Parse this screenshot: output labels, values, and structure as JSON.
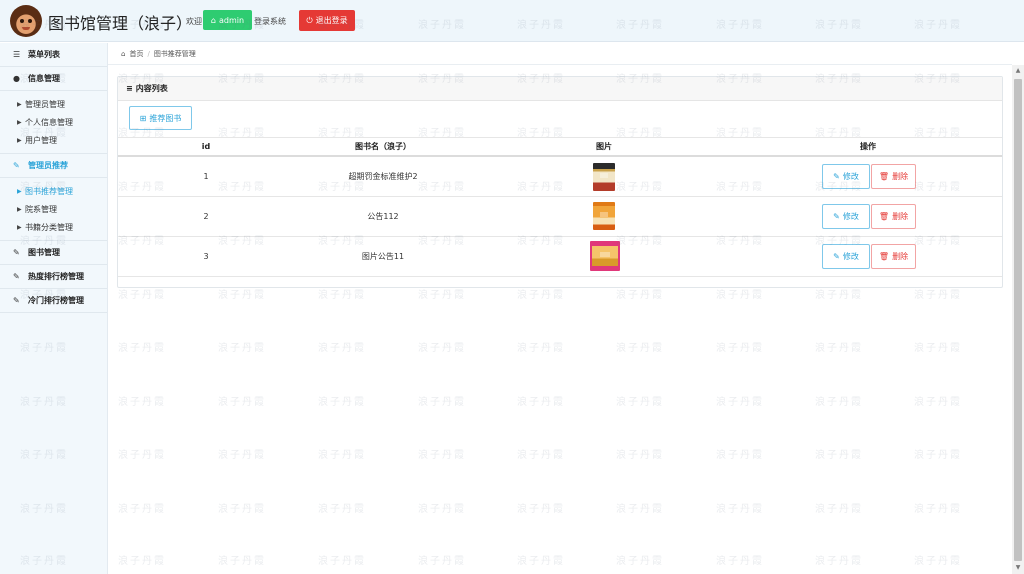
{
  "header": {
    "title": "图书馆管理（浪子）",
    "welcome": "欢迎",
    "user": "admin",
    "login_text": "登录系统",
    "logout": "退出登录"
  },
  "sidebar": {
    "menu_title": "菜单列表",
    "groups": [
      {
        "label": "信息管理",
        "icon": "user-icon",
        "items": [
          "管理员管理",
          "个人信息管理",
          "用户管理"
        ]
      },
      {
        "label": "管理员推荐",
        "icon": "edit-icon",
        "active": true,
        "items": [
          "图书推荐管理",
          "院系管理",
          "书籍分类管理"
        ],
        "active_item": "图书推荐管理"
      },
      {
        "label": "图书管理",
        "icon": "edit-icon"
      },
      {
        "label": "热度排行榜管理",
        "icon": "edit-icon"
      },
      {
        "label": "冷门排行榜管理",
        "icon": "edit-icon"
      }
    ]
  },
  "breadcrumb": {
    "home": "首页",
    "current": "图书推荐管理"
  },
  "panel": {
    "title": "内容列表",
    "add_button": "推荐图书",
    "columns": {
      "id": "id",
      "name": "图书名（浪子）",
      "image": "图片",
      "ops": "操作"
    },
    "rows": [
      {
        "id": "1",
        "name": "超期罚金标准维护2"
      },
      {
        "id": "2",
        "name": "公告112"
      },
      {
        "id": "3",
        "name": "图片公告11"
      }
    ],
    "edit_label": "修改",
    "delete_label": "删除"
  },
  "watermark": "浪子丹霞",
  "colors": {
    "accent": "#2aa3d8",
    "success": "#2ecc71",
    "danger": "#e53935"
  }
}
